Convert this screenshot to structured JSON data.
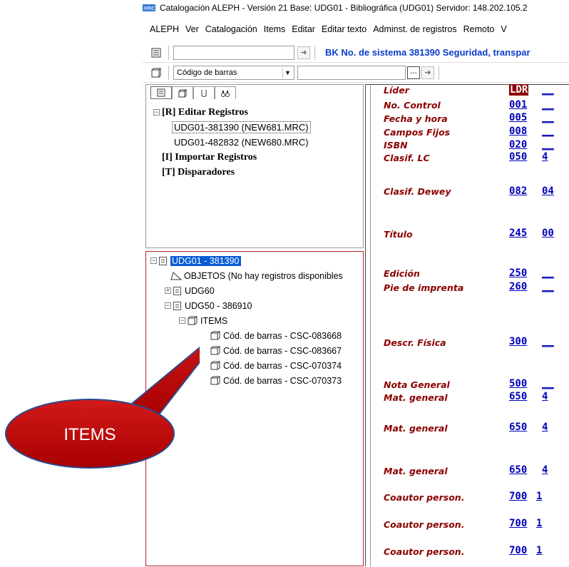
{
  "window": {
    "title": "Catalogación ALEPH - Versión 21  Base:  UDG01 - Bibliográfica (UDG01)  Servidor: 148.202.105.2"
  },
  "menu": [
    "ALEPH",
    "Ver",
    "Catalogación",
    "Items",
    "Editar",
    "Editar texto",
    "Adminst. de registros",
    "Remoto",
    "V"
  ],
  "toolbar": {
    "bk_text": "BK No. de sistema 381390 Seguridad, transpar",
    "search_type": "Código de barras",
    "dots": "..."
  },
  "upper_tree": {
    "root": "[R] Editar Registros",
    "children": [
      "UDG01-381390 (NEW681.MRC)",
      "UDG01-482832 (NEW680.MRC)"
    ],
    "import": "[I] Importar Registros",
    "triggers": "[T] Disparadores"
  },
  "lower_tree": {
    "root": "UDG01 - 381390",
    "objects": "OBJETOS (No hay registros disponibles",
    "udg60": "UDG60",
    "udg50": "UDG50 - 386910",
    "items_label": "ITEMS",
    "barcodes": [
      "Cód. de barras - CSC-083668",
      "Cód. de barras - CSC-083667",
      "Cód. de barras - CSC-070374",
      "Cód. de barras - CSC-070373"
    ]
  },
  "marc_fields": [
    {
      "label": "Líder",
      "tag": "LDR",
      "ind": "__",
      "is_leader": true
    },
    {
      "label": "No. Control",
      "tag": "001",
      "ind": "__"
    },
    {
      "label": "Fecha y hora",
      "tag": "005",
      "ind": "__"
    },
    {
      "label": "Campos Fijos",
      "tag": "008",
      "ind": "__"
    },
    {
      "label": "ISBN",
      "tag": "020",
      "ind": "__"
    },
    {
      "label": "Clasif. LC",
      "tag": "050",
      "ind": " 4"
    },
    {
      "label": "Clasif. Dewey",
      "tag": "082",
      "ind": "04"
    },
    {
      "label": "Título",
      "tag": "245",
      "ind": "00"
    },
    {
      "label": "Edición",
      "tag": "250",
      "ind": "__"
    },
    {
      "label": "Pie de imprenta",
      "tag": "260",
      "ind": "__"
    },
    {
      "label": "Descr. Física",
      "tag": "300",
      "ind": "__"
    },
    {
      "label": "Nota General",
      "tag": "500",
      "ind": "__"
    },
    {
      "label": "Mat. general",
      "tag": "650",
      "ind": " 4"
    },
    {
      "label": "Mat. general",
      "tag": "650",
      "ind": " 4"
    },
    {
      "label": "Mat. general",
      "tag": "650",
      "ind": " 4"
    },
    {
      "label": "Coautor person.",
      "tag": "700",
      "ind": "1 "
    },
    {
      "label": "Coautor person.",
      "tag": "700",
      "ind": "1 "
    },
    {
      "label": "Coautor person.",
      "tag": "700",
      "ind": "1 "
    }
  ],
  "callout": {
    "label": "ITEMS",
    "fill_color": "#c00000"
  }
}
